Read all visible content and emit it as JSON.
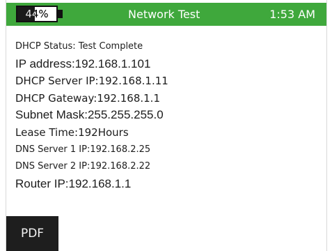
{
  "status_bar": {
    "battery_text": "44%",
    "battery_level": 0.44,
    "title": "Network Test",
    "time": "1:53 AM",
    "color": "#3fa83c"
  },
  "info": {
    "lines": [
      "DHCP Status: Test Complete",
      "IP address:192.168.1.101",
      "DHCP Server IP:192.168.1.11",
      "DHCP Gateway:192.168.1.1",
      "Subnet Mask:255.255.255.0",
      "Lease Time:192Hours",
      "DNS Server 1 IP:192.168.2.25",
      "DNS Server 2 IP:192.168.2.22",
      "Router IP:192.168.1.1"
    ]
  },
  "buttons": {
    "pdf_label": "PDF"
  }
}
